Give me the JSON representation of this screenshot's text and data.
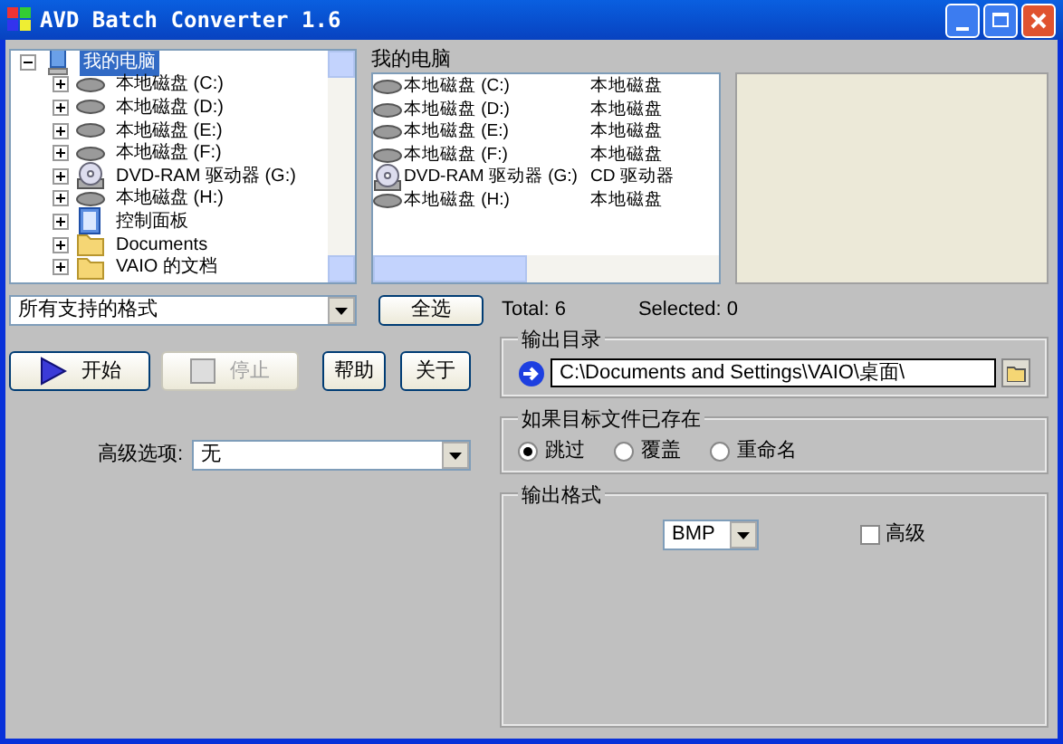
{
  "window": {
    "title": "AVD Batch Converter 1.6"
  },
  "tree": [
    {
      "label": "我的电脑",
      "kind": "computer",
      "selected": true,
      "expanded": true,
      "children": [
        {
          "label": "本地磁盘 (C:)",
          "kind": "drive",
          "selected": false,
          "expanded": false
        },
        {
          "label": "本地磁盘 (D:)",
          "kind": "drive",
          "selected": false,
          "expanded": false
        },
        {
          "label": "本地磁盘 (E:)",
          "kind": "drive",
          "selected": false,
          "expanded": false
        },
        {
          "label": "本地磁盘 (F:)",
          "kind": "drive",
          "selected": false,
          "expanded": false
        },
        {
          "label": "DVD-RAM 驱动器 (G:)",
          "kind": "dvd",
          "selected": false,
          "expanded": false
        },
        {
          "label": "本地磁盘 (H:)",
          "kind": "drive",
          "selected": false,
          "expanded": false
        },
        {
          "label": "控制面板",
          "kind": "panel",
          "selected": false,
          "expanded": false
        },
        {
          "label": "Documents",
          "kind": "folder",
          "selected": false,
          "expanded": false
        },
        {
          "label": "VAIO 的文档",
          "kind": "folder",
          "selected": false,
          "expanded": false
        }
      ]
    }
  ],
  "list": {
    "title": "我的电脑",
    "rows": [
      {
        "name": "本地磁盘 (C:)",
        "type": "本地磁盘",
        "kind": "drive"
      },
      {
        "name": "本地磁盘 (D:)",
        "type": "本地磁盘",
        "kind": "drive"
      },
      {
        "name": "本地磁盘 (E:)",
        "type": "本地磁盘",
        "kind": "drive"
      },
      {
        "name": "本地磁盘 (F:)",
        "type": "本地磁盘",
        "kind": "drive"
      },
      {
        "name": "DVD-RAM 驱动器 (G:)",
        "type": "CD 驱动器",
        "kind": "dvd"
      },
      {
        "name": "本地磁盘 (H:)",
        "type": "本地磁盘",
        "kind": "drive"
      }
    ]
  },
  "filter": {
    "value": "所有支持的格式"
  },
  "select_all": "全选",
  "total": "Total: 6",
  "selected_count": "Selected: 0",
  "buttons": [
    {
      "label": "开始",
      "kind": "start",
      "disabled": false
    },
    {
      "label": "停止",
      "kind": "stop",
      "disabled": true
    },
    {
      "label": "帮助",
      "kind": "plain",
      "disabled": false
    },
    {
      "label": "关于",
      "kind": "plain",
      "disabled": false
    }
  ],
  "advanced": {
    "label": "高级选项:",
    "value": "无"
  },
  "output_dir": {
    "title": "输出目录",
    "value": "C:\\Documents and Settings\\VAIO\\桌面\\"
  },
  "if_exists": {
    "title": "如果目标文件已存在",
    "options": [
      {
        "label": "跳过",
        "selected": true
      },
      {
        "label": "覆盖",
        "selected": false
      },
      {
        "label": "重命名",
        "selected": false
      }
    ]
  },
  "output_format": {
    "title": "输出格式",
    "value": "BMP",
    "advanced": {
      "label": "高级",
      "checked": false
    }
  }
}
